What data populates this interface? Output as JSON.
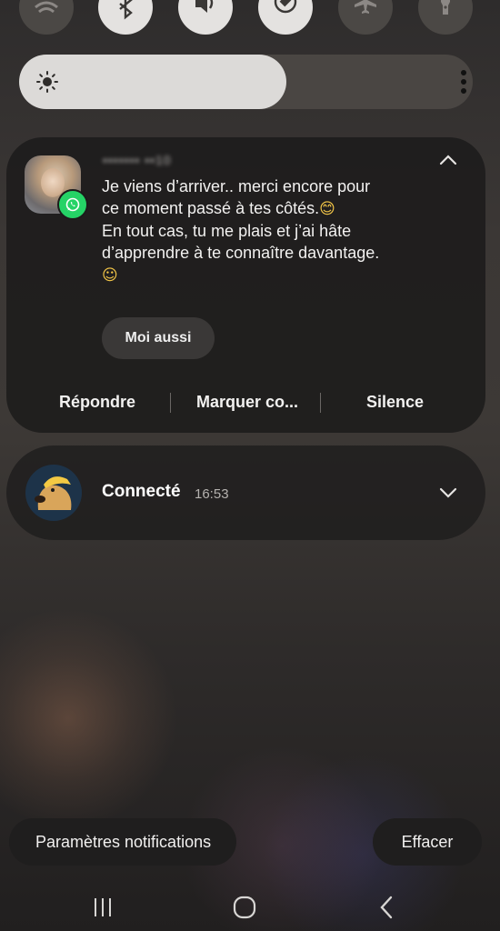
{
  "quick_settings": {
    "toggles": [
      {
        "name": "wifi-icon",
        "state": "off"
      },
      {
        "name": "bluetooth-icon",
        "state": "on"
      },
      {
        "name": "sound-icon",
        "state": "on"
      },
      {
        "name": "auto-rotate-icon",
        "state": "on"
      },
      {
        "name": "airplane-icon",
        "state": "off"
      },
      {
        "name": "flashlight-icon",
        "state": "off"
      }
    ],
    "brightness_level": 0.59
  },
  "notification_whatsapp": {
    "sender": "••••••• ••10",
    "message_line1": "Je viens d’arriver.. merci encore pour",
    "message_line2": "ce moment passé à tes côtés.",
    "message_line2_emoji": "😊",
    "message_line3": "En tout cas, tu me plais et j’ai hâte",
    "message_line4": "d’apprendre à te connaître davantage.",
    "message_line5_emoji": "☺",
    "quick_reply": "Moi aussi",
    "actions": {
      "reply": "Répondre",
      "mark_read": "Marquer co...",
      "mute": "Silence"
    }
  },
  "notification_vpn": {
    "title": "Connecté",
    "time": "16:53"
  },
  "footer": {
    "settings_label": "Paramètres notifications",
    "clear_label": "Effacer"
  },
  "colors": {
    "whatsapp_green": "#25d366",
    "card_bg": "#1c1b1b",
    "toggle_on": "#e4e2e0",
    "toggle_off": "#4b4845"
  }
}
